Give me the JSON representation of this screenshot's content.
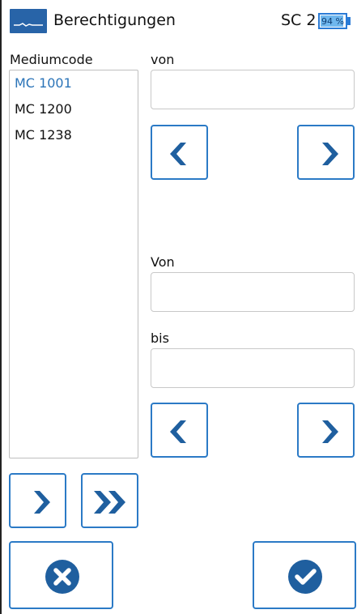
{
  "header": {
    "title": "Berechtigungen",
    "sc_label": "SC 2",
    "battery_text": "94 %",
    "battery_level_percent": 94
  },
  "list": {
    "label": "Mediumcode",
    "items": [
      {
        "label": "MC 1001",
        "selected": true
      },
      {
        "label": "MC 1200",
        "selected": false
      },
      {
        "label": "MC 1238",
        "selected": false
      }
    ]
  },
  "fields": {
    "von_label": "von",
    "von2_label": "Von",
    "bis_label": "bis"
  },
  "colors": {
    "accent": "#2b7ac6",
    "arrow": "#1f5f9f",
    "selected_text": "#2b74b8"
  },
  "icons": {
    "prev": "chevron-left-icon",
    "next": "chevron-right-icon",
    "add_one": "chevron-right-icon",
    "add_all": "double-chevron-right-icon",
    "cancel": "circle-x-icon",
    "confirm": "circle-check-icon"
  }
}
